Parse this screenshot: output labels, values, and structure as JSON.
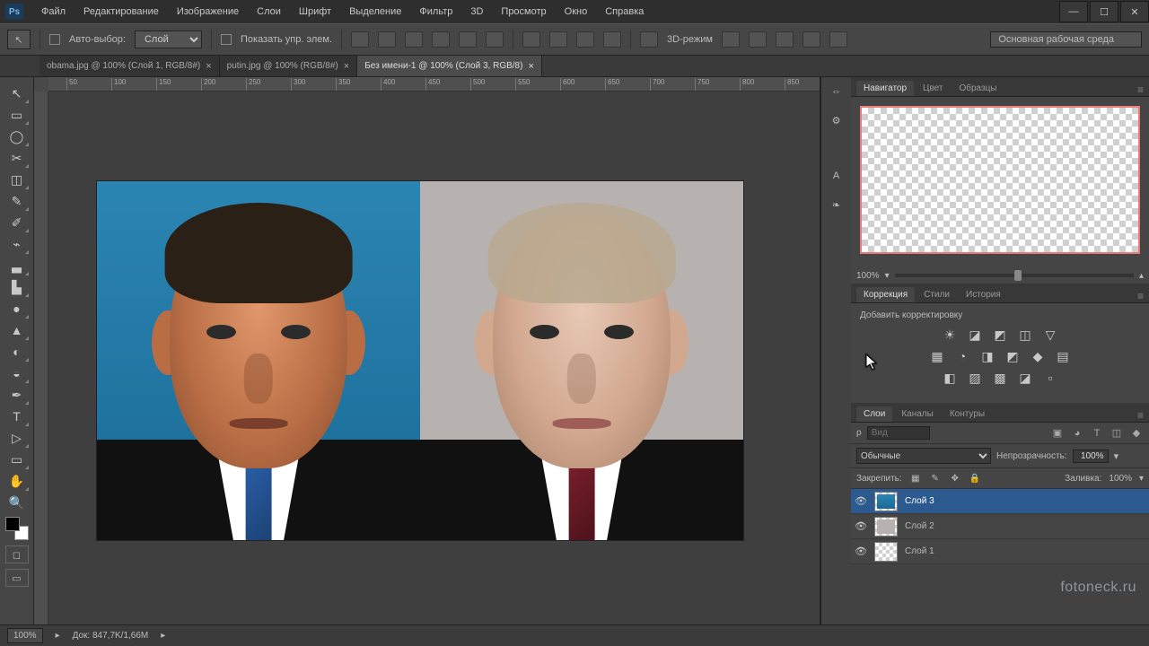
{
  "app": {
    "logo": "Ps"
  },
  "menu": [
    "Файл",
    "Редактирование",
    "Изображение",
    "Слои",
    "Шрифт",
    "Выделение",
    "Фильтр",
    "3D",
    "Просмотр",
    "Окно",
    "Справка"
  ],
  "options": {
    "auto_select": "Авто-выбор:",
    "target": "Слой",
    "show_controls": "Показать упр. элем.",
    "mode3d": "3D-режим",
    "workspace": "Основная рабочая среда"
  },
  "tabs": [
    {
      "label": "obama.jpg @ 100% (Слой 1, RGB/8#)",
      "active": false
    },
    {
      "label": "putin.jpg @ 100% (RGB/8#)",
      "active": false
    },
    {
      "label": "Без имени-1 @ 100% (Слой 3, RGB/8)",
      "active": true
    }
  ],
  "ruler_marks": [
    "50",
    "100",
    "150",
    "200",
    "250",
    "300",
    "350",
    "400",
    "450",
    "500",
    "550",
    "600",
    "650",
    "700",
    "750",
    "800",
    "850"
  ],
  "tools": [
    "↖",
    "▭",
    "◯",
    "✂",
    "✎",
    "✐",
    "⌁",
    "▃",
    "▙",
    "●",
    "▲",
    "◐",
    "◒",
    "T",
    "▷",
    "↔",
    "✋",
    "🔍"
  ],
  "minitools": [
    "⇔",
    "⚙",
    "A",
    "❧"
  ],
  "panels": {
    "nav": {
      "tabs": [
        "Навигатор",
        "Цвет",
        "Образцы"
      ],
      "active": 0,
      "zoom": "100%"
    },
    "adj": {
      "tabs": [
        "Коррекция",
        "Стили",
        "История"
      ],
      "active": 0,
      "hint": "Добавить корректировку",
      "rows": [
        [
          "☀",
          "◪",
          "◩",
          "◫",
          "▽"
        ],
        [
          "▦",
          "◔",
          "◨",
          "◩",
          "◆",
          "▤"
        ],
        [
          "◧",
          "▨",
          "▩",
          "◪",
          "▫"
        ]
      ]
    },
    "lay": {
      "tabs": [
        "Слои",
        "Каналы",
        "Контуры"
      ],
      "active": 0,
      "search_placeholder": "Вид",
      "filter_icons": [
        "▣",
        "◕",
        "T",
        "◫",
        "◆"
      ],
      "blend": "Обычные",
      "opacity_label": "Непрозрачность:",
      "opacity": "100%",
      "lock_label": "Закрепить:",
      "lock_icons": [
        "▦",
        "✎",
        "✥",
        "🔒"
      ],
      "fill_label": "Заливка:",
      "fill": "100%",
      "layers": [
        {
          "name": "Слой 3",
          "selected": true,
          "thumb": "imgl"
        },
        {
          "name": "Слой 2",
          "selected": false,
          "thumb": "imgr"
        },
        {
          "name": "Слой 1",
          "selected": false,
          "thumb": "blank"
        }
      ]
    }
  },
  "status": {
    "zoom": "100%",
    "doc": "Док: 847,7K/1,66M"
  },
  "watermark": "fotoneck.ru"
}
